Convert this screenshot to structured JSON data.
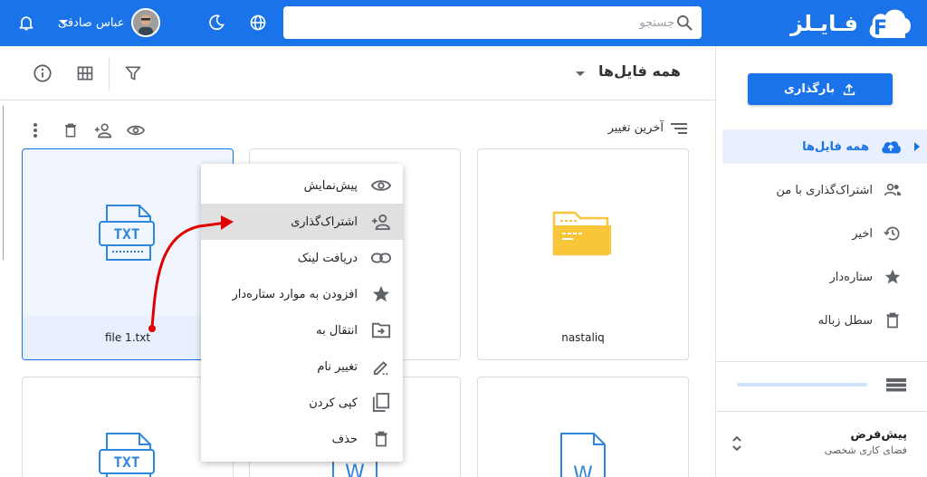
{
  "header": {
    "logo_text": "فـایـلز",
    "search_placeholder": "جستجو",
    "user_name": "عباس صادقی"
  },
  "sidebar": {
    "upload_label": "بارگذاری",
    "items": [
      {
        "label": "همه فایل‌ها",
        "icon": "cloud-upload-icon",
        "active": true
      },
      {
        "label": "اشتراک‌گذاری با من",
        "icon": "people-icon"
      },
      {
        "label": "اخیر",
        "icon": "history-icon"
      },
      {
        "label": "ستاره‌دار",
        "icon": "star-icon"
      },
      {
        "label": "سطل زباله",
        "icon": "trash-icon"
      }
    ],
    "workspace": {
      "title": "پیش‌فرض",
      "subtitle": "فضای کاری شخصی"
    }
  },
  "main": {
    "title": "همه فایل‌ها",
    "sort_label": "آخرین تغییر",
    "files": [
      {
        "name": "file 1.txt",
        "type": "txt",
        "selected": true
      },
      {
        "name": "",
        "type": "folder"
      },
      {
        "name": "nastaliq",
        "type": "folder"
      },
      {
        "name": "",
        "type": "txt"
      },
      {
        "name": "",
        "type": "word"
      },
      {
        "name": "",
        "type": "word"
      }
    ]
  },
  "context_menu": {
    "items": [
      {
        "label": "پیش‌نمایش",
        "icon": "eye-icon"
      },
      {
        "label": "اشتراک‌گذاری",
        "icon": "person-add-icon",
        "hover": true
      },
      {
        "label": "دریافت لینک",
        "icon": "link-icon"
      },
      {
        "label": "افزودن به موارد ستاره‌دار",
        "icon": "star-icon"
      },
      {
        "label": "انتقال به",
        "icon": "move-icon"
      },
      {
        "label": "تغییر نام",
        "icon": "rename-icon"
      },
      {
        "label": "کپی کردن",
        "icon": "copy-icon"
      },
      {
        "label": "حذف",
        "icon": "trash-icon"
      }
    ]
  },
  "colors": {
    "primary": "#1a73e8",
    "folder": "#f9c63a",
    "annotation_arrow": "#e00000"
  }
}
